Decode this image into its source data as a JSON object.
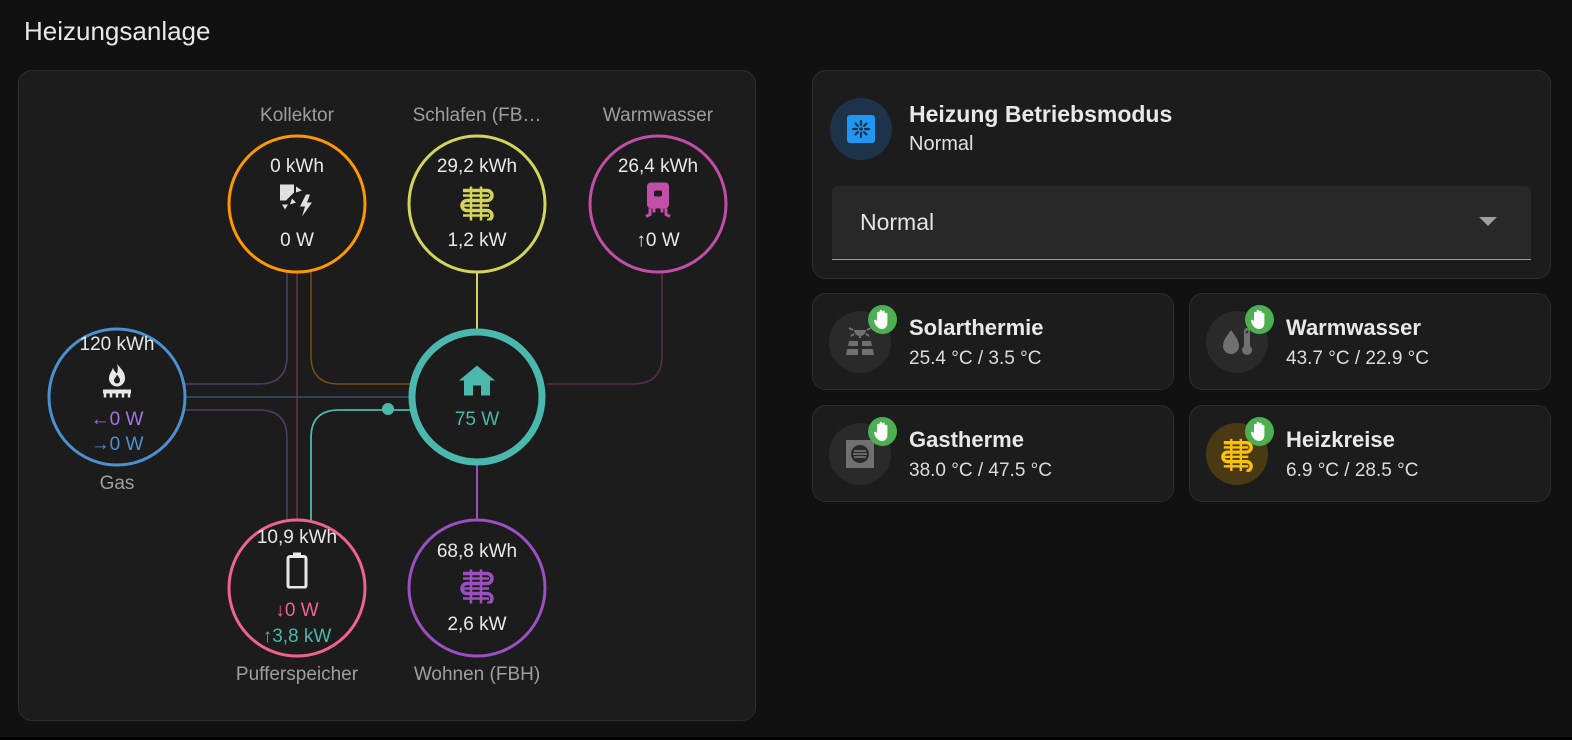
{
  "page": {
    "title": "Heizungsanlage"
  },
  "flow": {
    "colors": {
      "kollektor": "#ff9800",
      "schlafen": "#d4d45a",
      "warmwasser": "#c14ea8",
      "gas": "#4c91cf",
      "home": "#4bb8ad",
      "puffer": "#f06292",
      "wohnen": "#9c4fc3",
      "arrow_in": "#a374e0"
    },
    "nodes": {
      "kollektor": {
        "label": "Kollektor",
        "energy": "0 kWh",
        "power": "0 W",
        "icon": "solar-power-icon"
      },
      "schlafen": {
        "label": "Schlafen (FB…",
        "energy": "29,2 kWh",
        "power": "1,2 kW",
        "icon": "heating-coil-icon"
      },
      "warmwasser": {
        "label": "Warmwasser",
        "energy": "26,4 kWh",
        "power_arrow": "↑",
        "power": "0 W",
        "icon": "water-boiler-icon"
      },
      "gas": {
        "label": "Gas",
        "energy": "120 kWh",
        "in_arrow": "←",
        "in_power": "0 W",
        "out_arrow": "→",
        "out_power": "0 W",
        "icon": "gas-burner-icon"
      },
      "home": {
        "power": "75 W",
        "icon": "home-icon"
      },
      "puffer": {
        "label": "Pufferspeicher",
        "energy": "10,9 kWh",
        "in_arrow": "↓",
        "in_power": "0 W",
        "out_arrow": "↑",
        "out_power": "3,8 kW",
        "icon": "battery-icon"
      },
      "wohnen": {
        "label": "Wohnen (FBH)",
        "energy": "68,8 kWh",
        "power": "2,6 kW",
        "icon": "heating-coil-icon"
      }
    }
  },
  "mode": {
    "title": "Heizung Betriebsmodus",
    "state": "Normal",
    "select_value": "Normal",
    "icon": "heat-pump-icon",
    "accent": "#2196f3"
  },
  "tiles": [
    {
      "name": "Solarthermie",
      "value": "25.4 °C / 3.5 °C",
      "icon": "solar-panel-icon",
      "active": false
    },
    {
      "name": "Warmwasser",
      "value": "43.7 °C / 22.9 °C",
      "icon": "water-thermometer-icon",
      "active": false
    },
    {
      "name": "Gastherme",
      "value": "38.0 °C / 47.5 °C",
      "icon": "boiler-icon",
      "active": false
    },
    {
      "name": "Heizkreise",
      "value": "6.9 °C / 28.5 °C",
      "icon": "heating-coil-icon",
      "active": true,
      "accent": "#ffc107"
    }
  ],
  "badge": {
    "icon": "hand-icon",
    "color": "#4caf50"
  }
}
